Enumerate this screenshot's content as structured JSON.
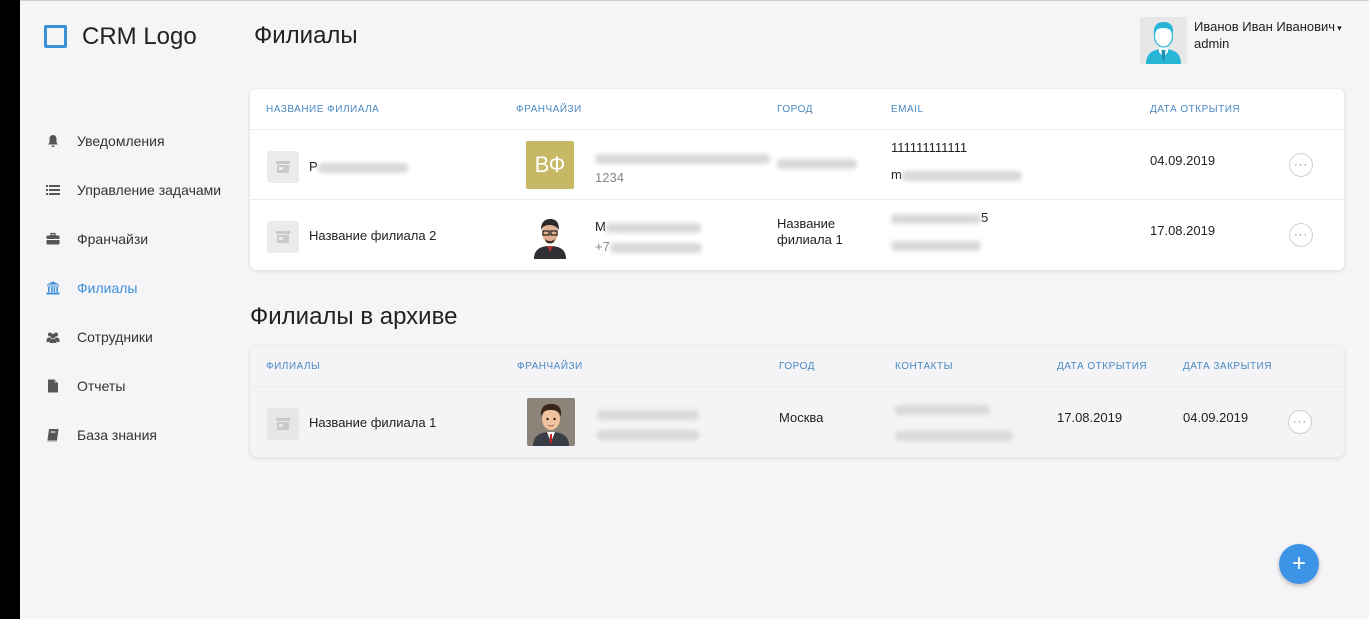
{
  "app": {
    "logo_text": "CRM Logo",
    "page_title": "Филиалы"
  },
  "user": {
    "name": "Иванов Иван Иванович",
    "role": "admin",
    "caret": "▾"
  },
  "sidebar": {
    "items": [
      {
        "label": "Уведомления",
        "icon": "bell-icon",
        "active": false
      },
      {
        "label": "Управление задачами",
        "icon": "list-icon",
        "active": false
      },
      {
        "label": "Франчайзи",
        "icon": "briefcase-icon",
        "active": false
      },
      {
        "label": "Филиалы",
        "icon": "bank-icon",
        "active": true
      },
      {
        "label": "Сотрудники",
        "icon": "users-icon",
        "active": false
      },
      {
        "label": "Отчеты",
        "icon": "file-icon",
        "active": false
      },
      {
        "label": "База знания",
        "icon": "book-icon",
        "active": false
      }
    ]
  },
  "branches": {
    "headers": {
      "name": "Название филиала",
      "franchisee": "Франчайзи",
      "city": "Город",
      "email": "Email",
      "opened": "Дата открытия"
    },
    "rows": [
      {
        "name_visible": "Р",
        "franchisee_initials": "ВФ",
        "franchisee_code": "1234",
        "city": "",
        "email_line1": "111111111111",
        "email_line2_visible": "m",
        "opened": "04.09.2019",
        "more": "···"
      },
      {
        "name_visible": "Название филиала 2",
        "franchisee_name_visible": "М",
        "franchisee_phone_visible": "+7",
        "city": "Название филиала 1",
        "email_tail_visible": "5",
        "opened": "17.08.2019",
        "more": "···"
      }
    ]
  },
  "archive": {
    "title": "Филиалы в архиве",
    "headers": {
      "name": "Филиалы",
      "franchisee": "Франчайзи",
      "city": "Город",
      "contacts": "Контакты",
      "opened": "Дата открытия",
      "closed": "Дата закрытия"
    },
    "rows": [
      {
        "name": "Название филиала 1",
        "city": "Москва",
        "opened": "17.08.2019",
        "closed": "04.09.2019",
        "more": "···"
      }
    ]
  },
  "fab": {
    "label": "+"
  },
  "colors": {
    "accent": "#3d8fd8",
    "header_text": "#4a89c2",
    "initials_bg": "#c6b865",
    "fab": "#3d94e6"
  }
}
